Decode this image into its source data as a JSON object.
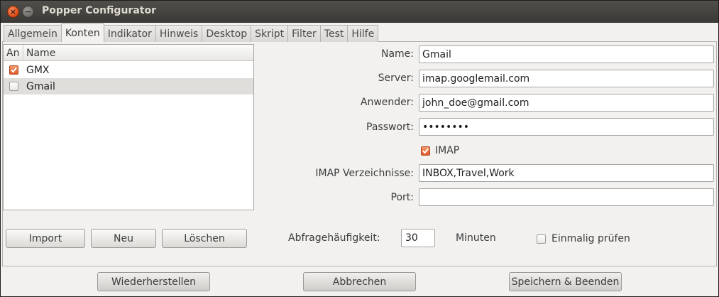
{
  "window": {
    "title": "Popper Configurator",
    "close_glyph": "×",
    "minimize_glyph": "−"
  },
  "tabs": [
    {
      "label": "Allgemein",
      "active": false
    },
    {
      "label": "Konten",
      "active": true
    },
    {
      "label": "Indikator",
      "active": false
    },
    {
      "label": "Hinweis",
      "active": false
    },
    {
      "label": "Desktop",
      "active": false
    },
    {
      "label": "Skript",
      "active": false
    },
    {
      "label": "Filter",
      "active": false
    },
    {
      "label": "Test",
      "active": false
    },
    {
      "label": "Hilfe",
      "active": false
    }
  ],
  "accounts": {
    "columns": {
      "enabled": "An",
      "name": "Name"
    },
    "rows": [
      {
        "name": "GMX",
        "enabled": true,
        "selected": false
      },
      {
        "name": "Gmail",
        "enabled": false,
        "selected": true
      }
    ]
  },
  "form": {
    "name_label": "Name:",
    "name_value": "Gmail",
    "server_label": "Server:",
    "server_value": "imap.googlemail.com",
    "user_label": "Anwender:",
    "user_value": "john_doe@gmail.com",
    "password_label": "Passwort:",
    "password_value": "••••••••",
    "imap_label": "IMAP",
    "imap_checked": true,
    "imap_folders_label": "IMAP Verzeichnisse:",
    "imap_folders_value": "INBOX,Travel,Work",
    "port_label": "Port:",
    "port_value": ""
  },
  "actions": {
    "import": "Import",
    "new": "Neu",
    "delete": "Löschen"
  },
  "polling": {
    "label": "Abfragehäufigkeit:",
    "value": "30",
    "unit": "Minuten",
    "once_label": "Einmalig prüfen",
    "once_checked": false
  },
  "footer": {
    "restore": "Wiederherstellen",
    "cancel": "Abbrechen",
    "save_exit": "Speichern & Beenden"
  },
  "colors": {
    "accent_check": "#e0582a",
    "close_button": "#dd4814",
    "titlebar": "#3b3a36"
  },
  "icons": {
    "check": "check-mark-icon"
  }
}
